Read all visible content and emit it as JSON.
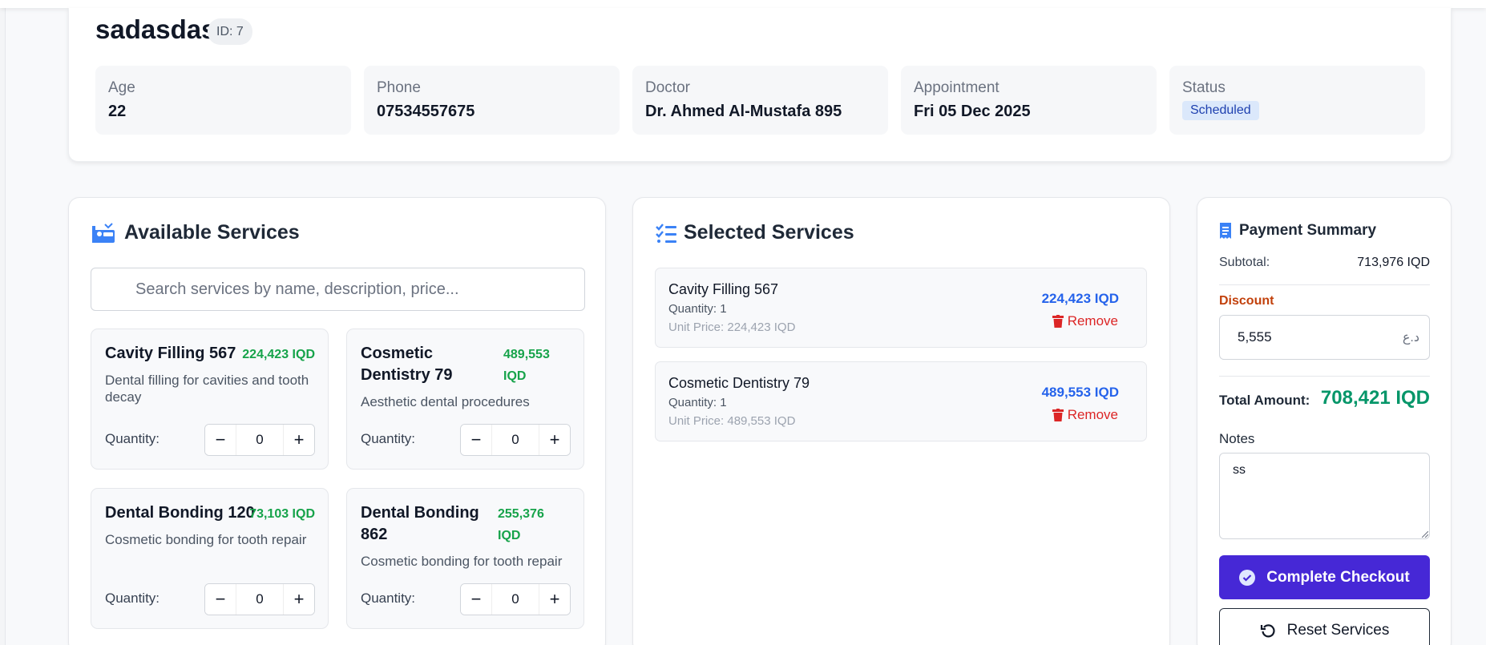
{
  "patient": {
    "name": "sadasdas",
    "id_badge": "ID: 7",
    "age_label": "Age",
    "age_value": "22",
    "phone_label": "Phone",
    "phone_value": "07534557675",
    "doctor_label": "Doctor",
    "doctor_value": "Dr. Ahmed Al-Mustafa 895",
    "appointment_label": "Appointment",
    "appointment_value": "Fri 05 Dec 2025",
    "status_label": "Status",
    "status_value": "Scheduled"
  },
  "available": {
    "title": "Available Services",
    "search_placeholder": "Search services by name, description, price...",
    "quantity_label": "Quantity:",
    "services": [
      {
        "name": "Cavity Filling 567",
        "price": "224,423 IQD",
        "description": "Dental filling for cavities and tooth decay",
        "quantity": "0"
      },
      {
        "name": "Cosmetic Dentistry 79",
        "price": "489,553 IQD",
        "description": "Aesthetic dental procedures",
        "quantity": "0"
      },
      {
        "name": "Dental Bonding 120",
        "price": "73,103 IQD",
        "description": "Cosmetic bonding for tooth repair",
        "quantity": "0"
      },
      {
        "name": "Dental Bonding 862",
        "price": "255,376 IQD",
        "description": "Cosmetic bonding for tooth repair",
        "quantity": "0"
      }
    ]
  },
  "selected": {
    "title": "Selected Services",
    "remove_label": "Remove",
    "items": [
      {
        "name": "Cavity Filling 567",
        "quantity": "Quantity: 1",
        "unit_price": "Unit Price: 224,423 IQD",
        "price": "224,423 IQD"
      },
      {
        "name": "Cosmetic Dentistry 79",
        "quantity": "Quantity: 1",
        "unit_price": "Unit Price: 489,553 IQD",
        "price": "489,553 IQD"
      }
    ]
  },
  "payment": {
    "title": "Payment Summary",
    "subtotal_label": "Subtotal:",
    "subtotal_value": "713,976 IQD",
    "discount_label": "Discount",
    "discount_value": "5,555",
    "discount_currency": "د.ع",
    "total_label": "Total Amount:",
    "total_value": "708,421 IQD",
    "notes_label": "Notes",
    "notes_value": "ss",
    "checkout_label": "Complete Checkout",
    "reset_label": "Reset Services"
  },
  "colors": {
    "accent": "#4628d6",
    "price_green": "#16a34a",
    "price_blue": "#2563eb",
    "remove_red": "#dc2626",
    "total_green": "#059669",
    "discount_orange": "#c2410c"
  }
}
